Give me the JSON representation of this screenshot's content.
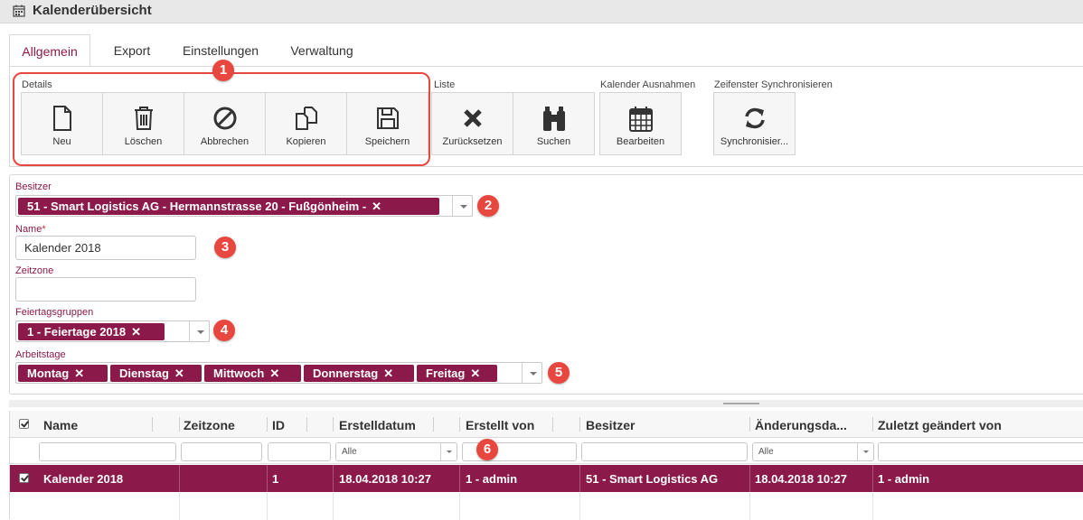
{
  "window": {
    "title": "Kalenderübersicht",
    "icon": "calendar-icon"
  },
  "tabs": [
    {
      "label": "Allgemein",
      "active": true
    },
    {
      "label": "Export",
      "active": false
    },
    {
      "label": "Einstellungen",
      "active": false
    },
    {
      "label": "Verwaltung",
      "active": false
    }
  ],
  "toolbar": {
    "groups": {
      "details": "Details",
      "liste": "Liste",
      "ausnahmen": "Kalender Ausnahmen",
      "sync": "Zeifenster Synchronisieren"
    },
    "buttons": {
      "neu": {
        "label": "Neu",
        "icon": "new-document-icon"
      },
      "loeschen": {
        "label": "Löschen",
        "icon": "trash-icon"
      },
      "abbrechen": {
        "label": "Abbrechen",
        "icon": "cancel-icon"
      },
      "kopieren": {
        "label": "Kopieren",
        "icon": "copy-icon"
      },
      "speichern": {
        "label": "Speichern",
        "icon": "save-icon"
      },
      "zuruecksetzen": {
        "label": "Zurücksetzen",
        "icon": "close-x-icon"
      },
      "suchen": {
        "label": "Suchen",
        "icon": "binoculars-icon"
      },
      "bearbeiten": {
        "label": "Bearbeiten",
        "icon": "calendar-grid-icon"
      },
      "synchronisieren": {
        "label": "Synchronisier...",
        "icon": "refresh-icon"
      }
    }
  },
  "callouts": [
    "1",
    "2",
    "3",
    "4",
    "5",
    "6"
  ],
  "form": {
    "besitzer": {
      "label": "Besitzer",
      "tag": "51 - Smart Logistics AG - Hermannstrasse 20 - Fußgönheim -"
    },
    "name": {
      "label": "Name",
      "required_mark": "*",
      "value": "Kalender 2018"
    },
    "zeitzone": {
      "label": "Zeitzone",
      "value": ""
    },
    "feiertagsgruppen": {
      "label": "Feiertagsgruppen",
      "tag": "1 - Feiertage 2018"
    },
    "arbeitstage": {
      "label": "Arbeitstage",
      "tags": [
        "Montag",
        "Dienstag",
        "Mittwoch",
        "Donnerstag",
        "Freitag"
      ]
    },
    "tag_remove": "✕"
  },
  "grid": {
    "columns": [
      "Name",
      "Zeitzone",
      "ID",
      "Erstelldatum",
      "Erstellt von",
      "Besitzer",
      "Änderungsda...",
      "Zuletzt geändert von"
    ],
    "filters": {
      "erstelldatum": "Alle",
      "aenderungsdatum": "Alle"
    },
    "rows": [
      {
        "selected": true,
        "cells": [
          "Kalender 2018",
          "",
          "1",
          "18.04.2018 10:27",
          "1 - admin",
          "51 - Smart Logistics AG",
          "18.04.2018 10:27",
          "1 - admin"
        ]
      }
    ]
  },
  "colors": {
    "accent": "#8b1a4a",
    "callout": "#e8473f"
  }
}
